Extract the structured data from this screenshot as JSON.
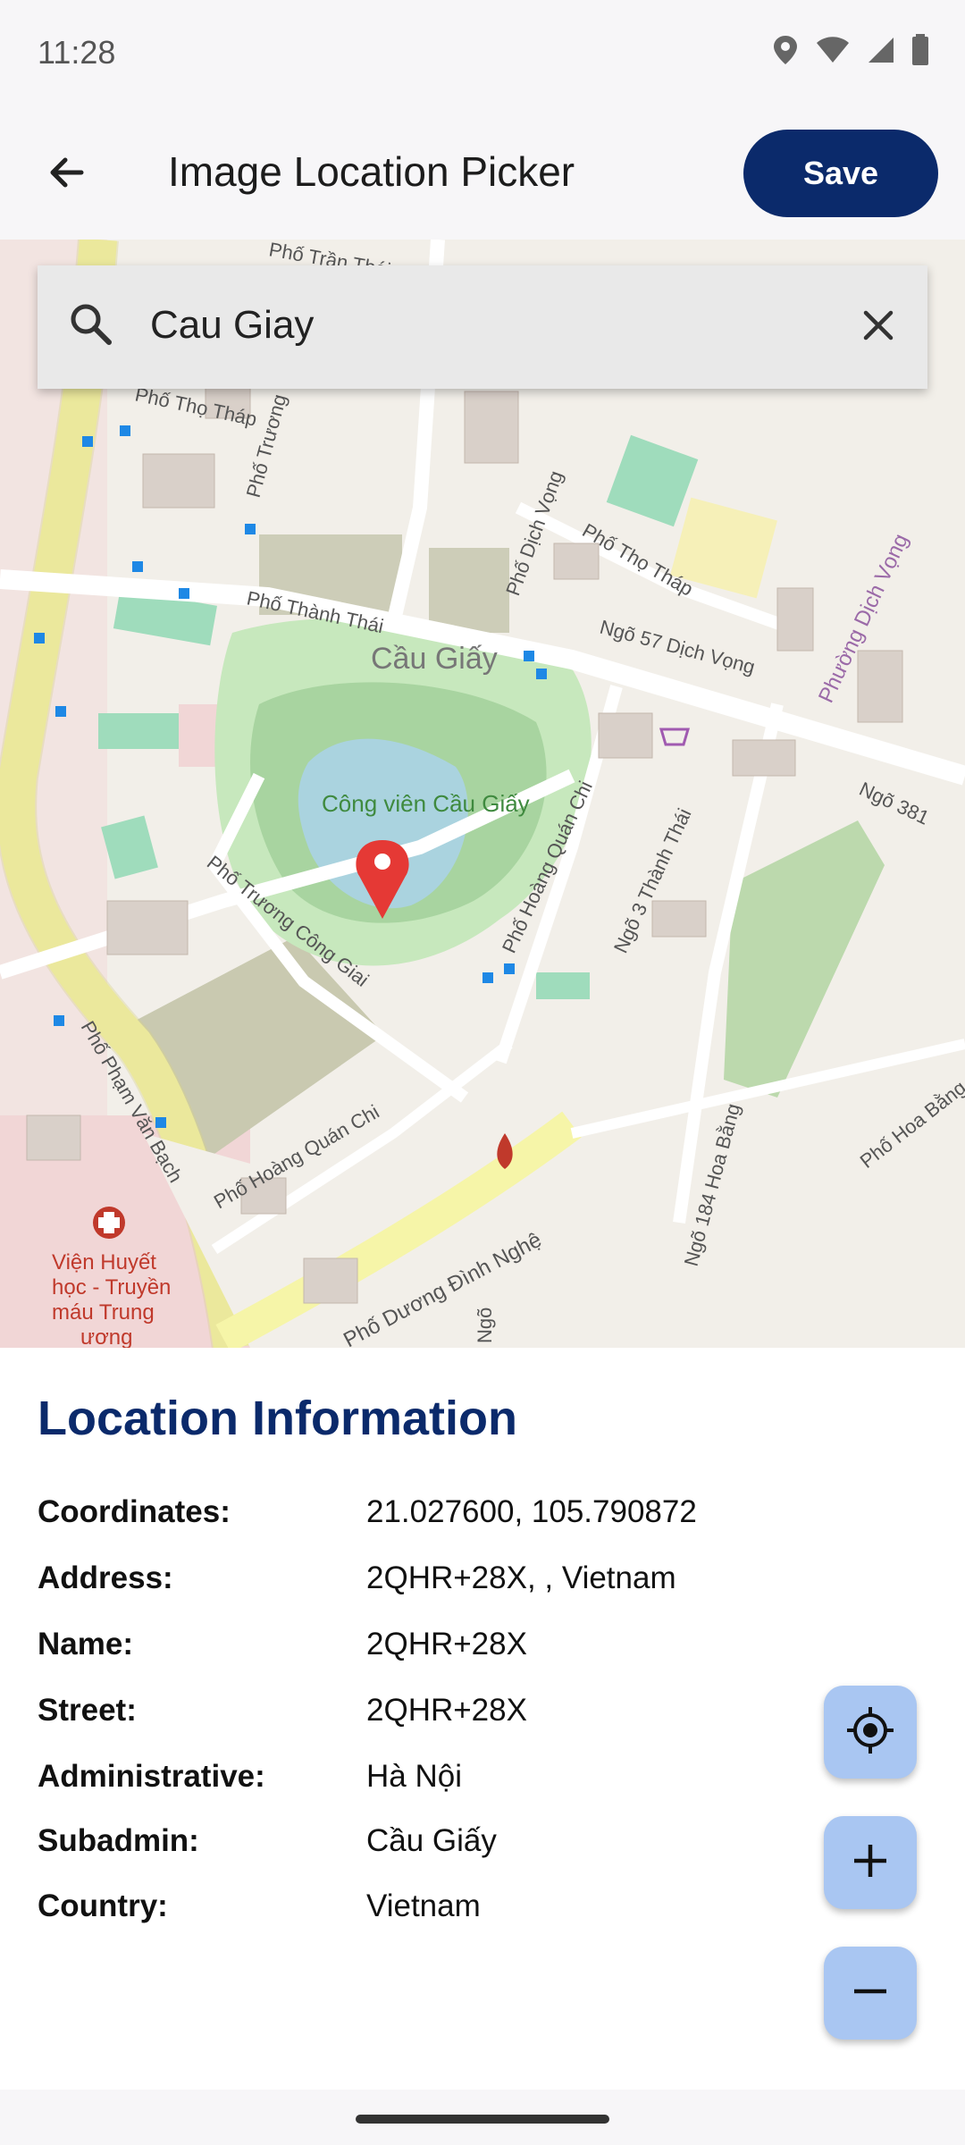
{
  "status": {
    "time": "11:28",
    "icons": [
      "location-icon",
      "wifi-icon",
      "signal-icon",
      "battery-icon"
    ]
  },
  "app_bar": {
    "title": "Image Location Picker",
    "save_label": "Save"
  },
  "search": {
    "value": "Cau Giay"
  },
  "map": {
    "labels": {
      "district": "Cầu Giấy",
      "park": "Công viên Cầu Giấy",
      "st_tran_thai": "Phố Trần Thái",
      "st_tho_thap_1": "Phố Thọ Tháp",
      "st_tho_thap_2": "Phố Thọ Tháp",
      "st_thanh_thai": "Phố Thành Thái",
      "st_truong_1": "Phố Trương",
      "st_dich_vong": "Phố Dịch Vọng",
      "st_ngo57": "Ngõ 57 Dịch Vọng",
      "ward": "Phường Dịch Vọng",
      "st_ngo381": "Ngõ 381",
      "st_hoang_quan_chi_1": "Phố Hoàng Quán Chi",
      "st_ngo3_thanh_thai": "Ngõ 3 Thành Thái",
      "st_truong_cong_giai": "Phố Trương Công Giai",
      "st_pham_van_bach": "Phố Phạm Văn Bạch",
      "st_hoang_quan_chi_2": "Phố Hoàng Quán Chi",
      "st_ngo184": "Ngõ 184 Hoa Bằng",
      "st_hoa_bang": "Phố Hoa Bằng",
      "st_duong_dinh_nghe": "Phố Dương Đình Nghệ",
      "hospital_1": "Viện Huyết",
      "hospital_2": "học - Truyền",
      "hospital_3": "máu Trung",
      "hospital_4": "ương",
      "st_ngo_bottom": "Ngõ"
    }
  },
  "info": {
    "title": "Location Information",
    "rows": [
      {
        "label": "Coordinates:",
        "value": "21.027600, 105.790872"
      },
      {
        "label": "Address:",
        "value": "2QHR+28X, , Vietnam"
      },
      {
        "label": "Name:",
        "value": "2QHR+28X"
      },
      {
        "label": "Street:",
        "value": "2QHR+28X"
      },
      {
        "label": "Administrative:",
        "value": "Hà Nội"
      },
      {
        "label": "Subadmin:",
        "value": "Cầu Giấy"
      },
      {
        "label": "Country:",
        "value": "Vietnam"
      }
    ]
  },
  "fabs": [
    "my-location-icon",
    "zoom-in-icon",
    "zoom-out-icon"
  ],
  "colors": {
    "primary": "#0b2a6b",
    "fab": "#a9c6f2",
    "marker": "#e53935",
    "park": "#a8d4a0",
    "water": "#aad3df"
  }
}
